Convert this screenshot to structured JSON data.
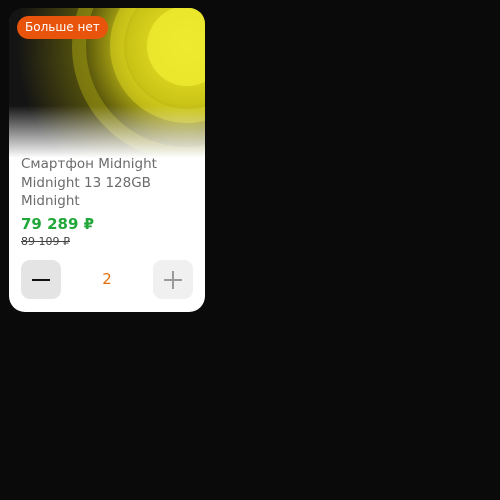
{
  "product": {
    "badge": "Больше нет",
    "title": "Смартфон Midnight Midnight 13 128GB Midnight",
    "price": "79 289 ₽",
    "old_price": "89 109 ₽",
    "image_icon": "product-image",
    "accent_color": "#e8540c",
    "price_color": "#22a83a"
  },
  "cart": {
    "quantity": "2",
    "decrement_icon": "minus-icon",
    "increment_icon": "plus-icon"
  }
}
